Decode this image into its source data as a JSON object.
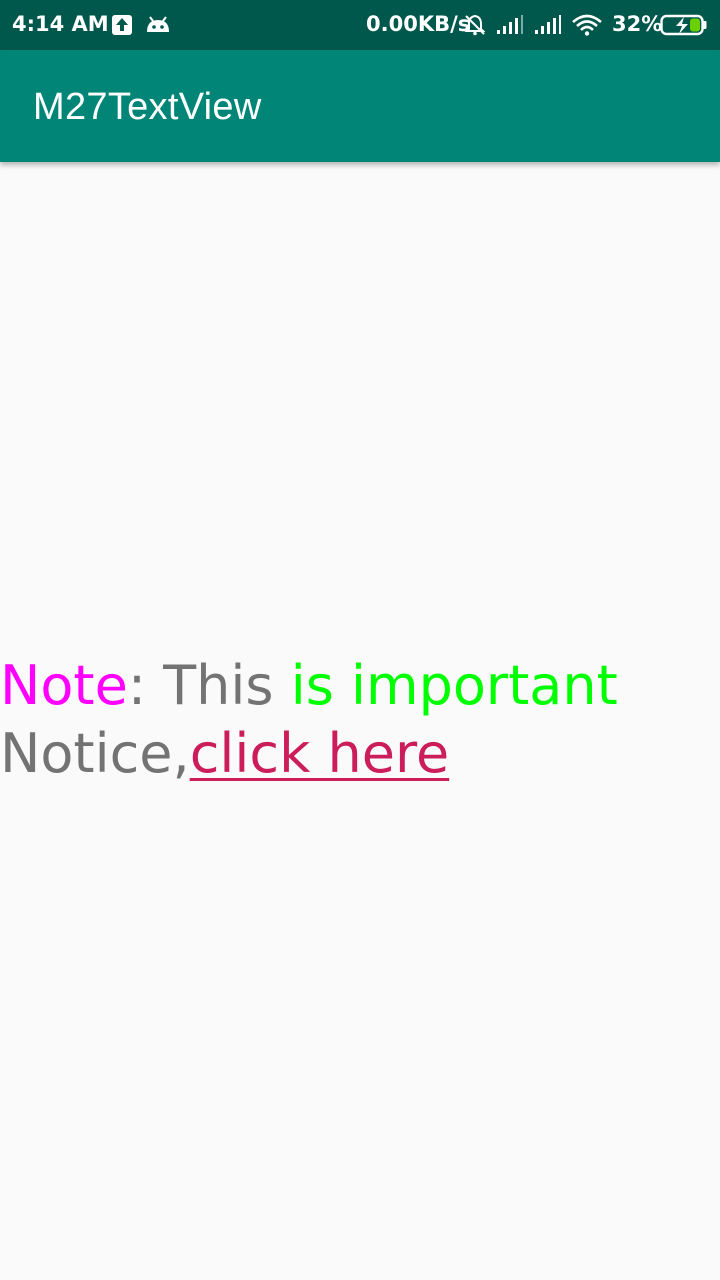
{
  "status_bar": {
    "time": "4:14 AM",
    "network_speed": "0.00KB/s",
    "battery_percent": "32%",
    "icons": [
      "upload-notification-icon",
      "android-debug-icon",
      "bell-muted-icon",
      "signal-icon",
      "signal-icon",
      "wifi-icon",
      "battery-charging-icon"
    ]
  },
  "app_bar": {
    "title": "M27TextView"
  },
  "content": {
    "note_word": "Note",
    "colon_text": ": This ",
    "important_text": "is important",
    "notice_text": "Notice,",
    "link_text": "click here"
  },
  "colors": {
    "status_bar": "#00574b",
    "app_bar": "#008577",
    "background": "#fafafa",
    "note": "#ff00ff",
    "plain": "#737373",
    "important": "#00ff00",
    "link": "#cc1d5b"
  }
}
